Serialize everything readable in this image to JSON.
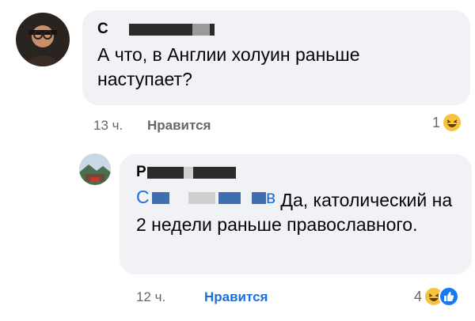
{
  "comment1": {
    "author_initial": "С",
    "text": "А что, в Англии холуин раньше наступает?",
    "time": "13 ч.",
    "like_label": "Нравится",
    "reaction_count": "1"
  },
  "comment2": {
    "author_initial": "Р",
    "mention_initial": "С",
    "mention_tail": "в",
    "text": "Да, католический на 2 недели раньше православного.",
    "time": "12 ч.",
    "like_label": "Нравится",
    "reaction_count": "4",
    "like_color": "#1b6fd9"
  },
  "icons": [
    "avatar",
    "haha-emoji-icon",
    "like-reaction-icon"
  ]
}
